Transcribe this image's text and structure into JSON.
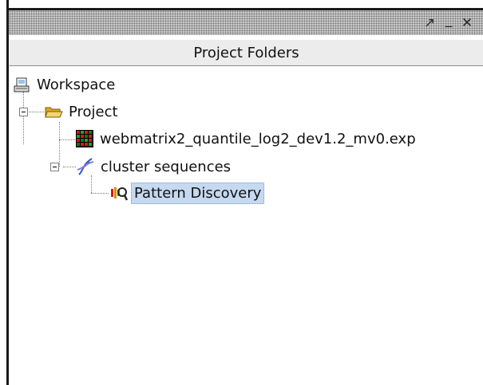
{
  "window": {
    "controls": {
      "maximize_glyph": "↗",
      "minimize_glyph": "_",
      "close_glyph": "✕"
    }
  },
  "panel": {
    "title": "Project Folders"
  },
  "tree": {
    "workspace": {
      "label": "Workspace",
      "icon": "workspace-icon"
    },
    "project": {
      "label": "Project",
      "icon": "open-folder-icon",
      "expanded": true
    },
    "data_file": {
      "label": "webmatrix2_quantile_log2_dev1.2_mv0.exp",
      "icon": "heatmap-file-icon"
    },
    "cluster": {
      "label": "cluster sequences",
      "icon": "dna-helix-icon",
      "expanded": true
    },
    "pattern": {
      "label": "Pattern Discovery",
      "icon": "pattern-discovery-icon",
      "selected": true
    }
  },
  "colors": {
    "selection_bg": "#c5d9f0",
    "folder": "#f2c14e"
  }
}
